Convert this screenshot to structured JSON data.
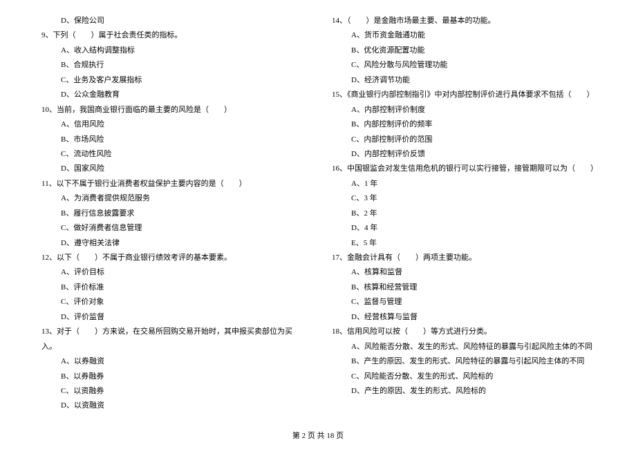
{
  "left": [
    {
      "type": "opt",
      "text": "D、保险公司"
    },
    {
      "type": "q",
      "text": "9、下列（　　）属于社会责任类的指标。"
    },
    {
      "type": "opt",
      "text": "A、收入结构调整指标"
    },
    {
      "type": "opt",
      "text": "B、合规执行"
    },
    {
      "type": "opt",
      "text": "C、业务及客户发展指标"
    },
    {
      "type": "opt",
      "text": "D、公众金融教育"
    },
    {
      "type": "q",
      "text": "10、当前，我国商业银行面临的最主要的风险是（　　）"
    },
    {
      "type": "opt",
      "text": "A、信用风险"
    },
    {
      "type": "opt",
      "text": "B、市场风险"
    },
    {
      "type": "opt",
      "text": "C、流动性风险"
    },
    {
      "type": "opt",
      "text": "D、国家风险"
    },
    {
      "type": "q",
      "text": "11、以下不属于银行业消费者权益保护主要内容的是（　　）"
    },
    {
      "type": "opt",
      "text": "A、为消费者提供规范服务"
    },
    {
      "type": "opt",
      "text": "B、履行信息披露要求"
    },
    {
      "type": "opt",
      "text": "C、做好消费者信息管理"
    },
    {
      "type": "opt",
      "text": "D、遵守相关法律"
    },
    {
      "type": "q",
      "text": "12、以下（　　）不属于商业银行绩效考评的基本要素。"
    },
    {
      "type": "opt",
      "text": "A、评价目标"
    },
    {
      "type": "opt",
      "text": "B、评价标准"
    },
    {
      "type": "opt",
      "text": "C、评价对象"
    },
    {
      "type": "opt",
      "text": "D、评价监督"
    },
    {
      "type": "q",
      "text": "13、对于（　　）方来说，在交易所回购交易开始时，其申报买卖部位为买入。"
    },
    {
      "type": "opt",
      "text": "A、以券融资"
    },
    {
      "type": "opt",
      "text": "B、以券融券"
    },
    {
      "type": "opt",
      "text": "C、以资融券"
    },
    {
      "type": "opt",
      "text": "D、以资融资"
    }
  ],
  "right": [
    {
      "type": "q",
      "text": "14、（　　）是金融市场最主要、最基本的功能。"
    },
    {
      "type": "opt",
      "text": "A、货币资金融通功能"
    },
    {
      "type": "opt",
      "text": "B、优化资源配置功能"
    },
    {
      "type": "opt",
      "text": "C、风险分散与风险管理功能"
    },
    {
      "type": "opt",
      "text": "D、经济调节功能"
    },
    {
      "type": "q",
      "text": "15、《商业银行内部控制指引》中对内部控制评价进行具体要求不包括（　　）"
    },
    {
      "type": "opt",
      "text": "A、内部控制评价制度"
    },
    {
      "type": "opt",
      "text": "B、内部控制评价的频率"
    },
    {
      "type": "opt",
      "text": "C、内部控制评价的范围"
    },
    {
      "type": "opt",
      "text": "D、内部控制评价反馈"
    },
    {
      "type": "q",
      "text": "16、中国银监会对发生信用危机的银行可以实行接管，接管期限可以为（　　）"
    },
    {
      "type": "opt",
      "text": "A、1 年"
    },
    {
      "type": "opt",
      "text": "C、3 年"
    },
    {
      "type": "opt",
      "text": "B、2 年"
    },
    {
      "type": "opt",
      "text": "D、4 年"
    },
    {
      "type": "opt",
      "text": "E、5 年"
    },
    {
      "type": "q",
      "text": "17、金融会计具有（　　）两项主要功能。"
    },
    {
      "type": "opt",
      "text": "A、核算和监督"
    },
    {
      "type": "opt",
      "text": "B、核算和经营管理"
    },
    {
      "type": "opt",
      "text": "C、监督与管理"
    },
    {
      "type": "opt",
      "text": "D、经营核算与监督"
    },
    {
      "type": "q",
      "text": "18、信用风险可以按（　　）等方式进行分类。"
    },
    {
      "type": "opt",
      "text": "A、风险能否分散、发生的形式、风险特征的暴露与引起风险主体的不同"
    },
    {
      "type": "opt",
      "text": "B、产生的原因、发生的形式、风险特征的暴露与引起风险主体的不同"
    },
    {
      "type": "opt",
      "text": "C、风险能否分散、发生的形式、风险标的"
    },
    {
      "type": "opt",
      "text": "D、产生的原因、发生的形式、风险标的"
    }
  ],
  "footer": "第 2 页 共 18 页"
}
